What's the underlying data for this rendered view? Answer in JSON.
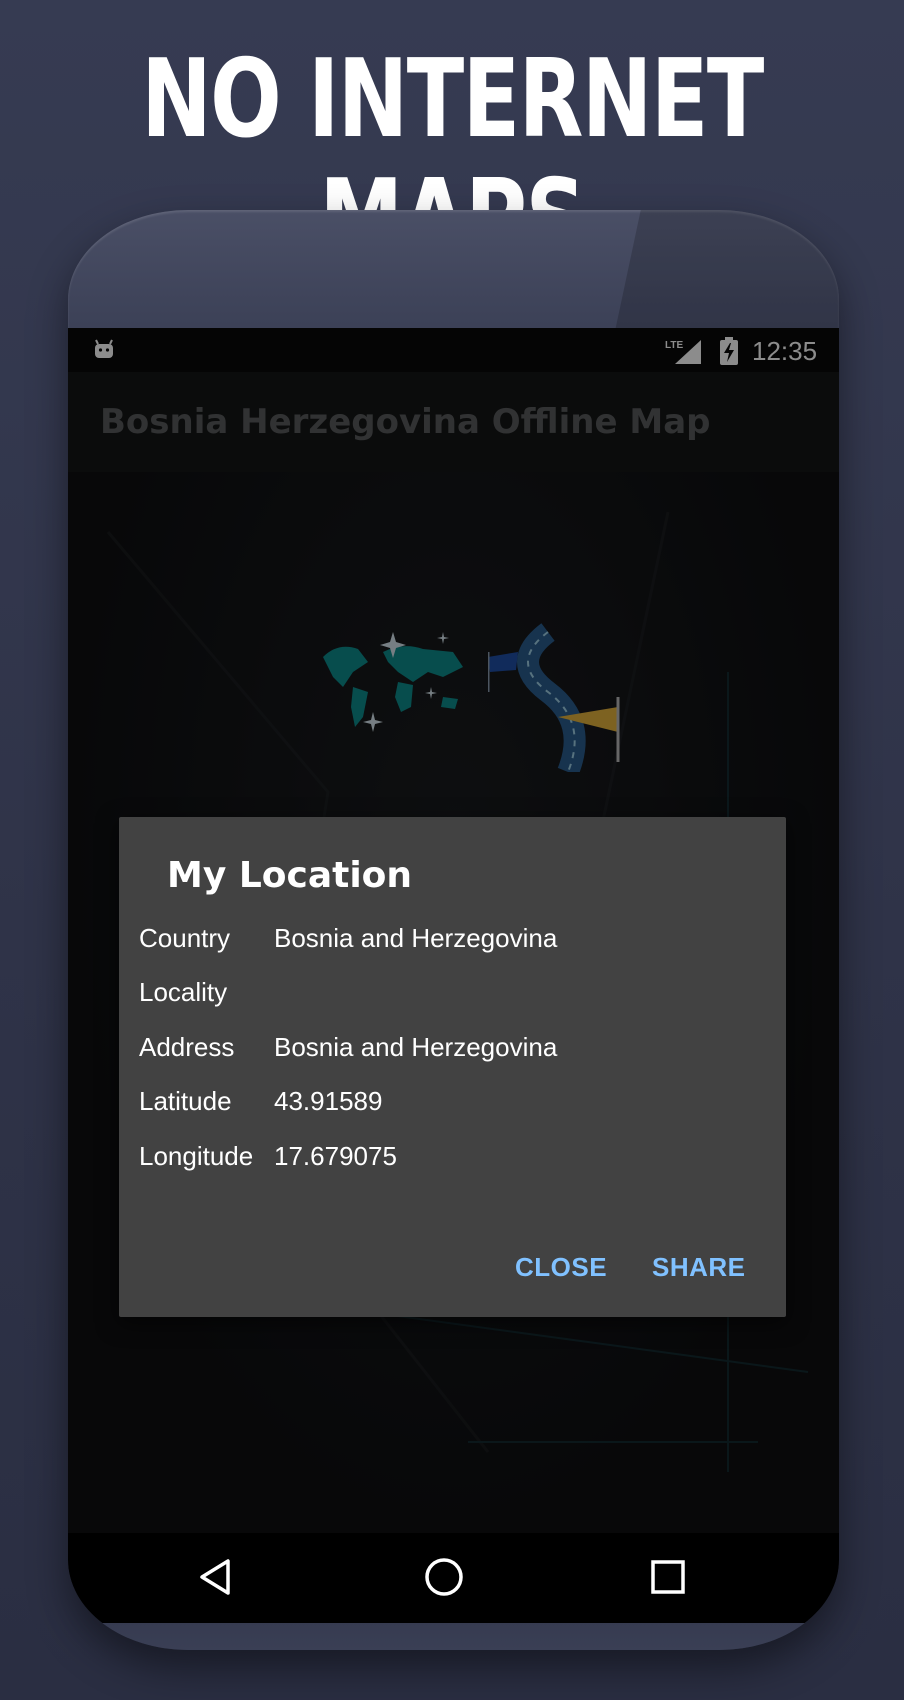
{
  "promo": {
    "headline": "NO INTERNET MAPS"
  },
  "status_bar": {
    "time": "12:35",
    "network_label": "LTE",
    "icons": [
      "android-icon",
      "lte-signal-icon",
      "battery-charging-icon"
    ]
  },
  "app_bar": {
    "title": "Bosnia Herzegovina Offline Map"
  },
  "background_tiles": {
    "icons": [
      "world-map-icon",
      "route-icon"
    ]
  },
  "dialog": {
    "title": "My Location",
    "rows": [
      {
        "label": "Country",
        "value": "Bosnia and Herzegovina"
      },
      {
        "label": "Locality",
        "value": ""
      },
      {
        "label": "Address",
        "value": "Bosnia and Herzegovina"
      },
      {
        "label": "Latitude",
        "value": "43.91589"
      },
      {
        "label": "Longitude",
        "value": "17.679075"
      }
    ],
    "close_label": "CLOSE",
    "share_label": "SHARE"
  },
  "nav_bar": {
    "icons": [
      "back-icon",
      "home-icon",
      "recents-icon"
    ]
  },
  "colors": {
    "background": "#2f3348",
    "dialog": "#424242",
    "dialog_button": "#80c1ff",
    "teal_map": "#0e8c8c"
  }
}
